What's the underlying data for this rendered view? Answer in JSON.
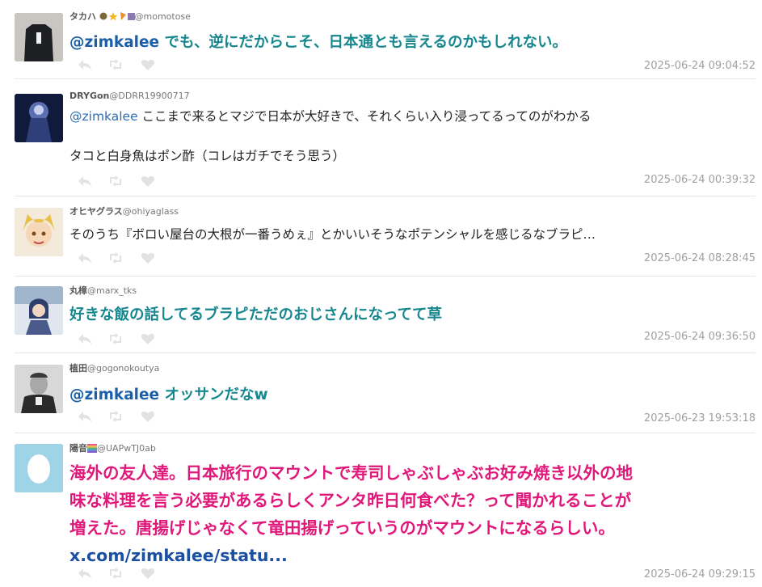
{
  "tweets": [
    {
      "name": "タカハ",
      "handle": "@momotose",
      "text_mention": "@zimkalee",
      "text": " でも、逆にだからこそ、日本通とも言えるのかもしれない。",
      "time": "2025-06-24 09:04:52"
    },
    {
      "name": "DRYGon",
      "handle": "@DDRR19900717",
      "text_mention": "@zimkalee",
      "text": " ここまで来るとマジで日本が大好きで、それくらい入り浸ってるってのがわかる",
      "text2": "タコと白身魚はポン酢（コレはガチでそう思う）",
      "time": "2025-06-24 00:39:32"
    },
    {
      "name": "オヒヤグラス",
      "handle": "@ohiyaglass",
      "text": "そのうち『ボロい屋台の大根が一番うめぇ』とかいいそうなポテンシャルを感じるなブラピ…",
      "time": "2025-06-24 08:28:45"
    },
    {
      "name": "丸樟",
      "handle": "@marx_tks",
      "text": "好きな飯の話してるブラピただのおじさんになってて草",
      "time": "2025-06-24 09:36:50"
    },
    {
      "name": "植田",
      "handle": "@gogonokoutya",
      "text_mention": "@zimkalee",
      "text": " オッサンだなw",
      "time": "2025-06-23 19:53:18"
    },
    {
      "name": "陽音",
      "handle": "@UAPwTJ0ab",
      "text_lines": [
        "海外の友人達。日本旅行のマウントで寿司しゃぶしゃぶお好み焼き以外の地",
        "味な料理を言う必要があるらしくアンタ昨日何食べた？って聞かれることが",
        "増えた。唐揚げじゃなくて竜田揚げっていうのがマウントになるらしい。"
      ],
      "link": "x.com/zimkalee/statu...",
      "time": "2025-06-24 09:29:15"
    }
  ],
  "icons": [
    "reply-icon",
    "retweet-icon",
    "like-icon"
  ],
  "colors": {
    "teal": "#16878e",
    "magenta": "#e0187a",
    "mention": "#1b5fa8",
    "timestamp": "#a0a0a0"
  }
}
